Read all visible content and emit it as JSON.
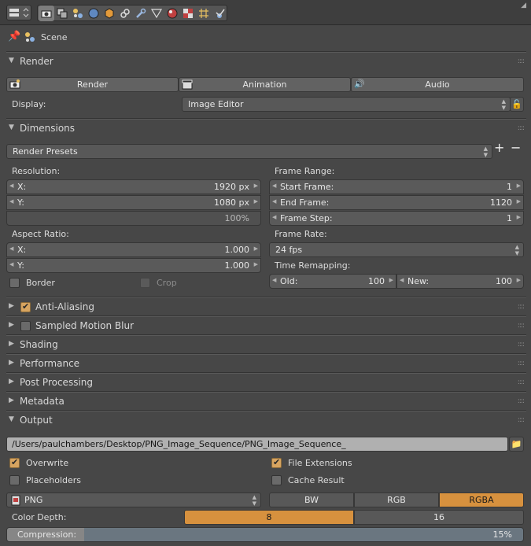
{
  "context": {
    "label": "Scene"
  },
  "render": {
    "title": "Render",
    "render_btn": "Render",
    "animation_btn": "Animation",
    "audio_btn": "Audio",
    "display_label": "Display:",
    "display_value": "Image Editor"
  },
  "dimensions": {
    "title": "Dimensions",
    "presets": "Render Presets",
    "resolution_label": "Resolution:",
    "res_x_label": "X:",
    "res_x": "1920 px",
    "res_y_label": "Y:",
    "res_y": "1080 px",
    "res_pct": "100%",
    "aspect_label": "Aspect Ratio:",
    "asp_x_label": "X:",
    "asp_x": "1.000",
    "asp_y_label": "Y:",
    "asp_y": "1.000",
    "border_label": "Border",
    "crop_label": "Crop",
    "frame_range_label": "Frame Range:",
    "start_label": "Start Frame:",
    "start": "1",
    "end_label": "End Frame:",
    "end": "1120",
    "step_label": "Frame Step:",
    "step": "1",
    "frame_rate_label": "Frame Rate:",
    "frame_rate": "24 fps",
    "remap_label": "Time Remapping:",
    "old_label": "Old:",
    "old": "100",
    "new_label": "New:",
    "new": "100"
  },
  "panels": {
    "anti_aliasing": "Anti-Aliasing",
    "motion_blur": "Sampled Motion Blur",
    "shading": "Shading",
    "performance": "Performance",
    "post_processing": "Post Processing",
    "metadata": "Metadata"
  },
  "output": {
    "title": "Output",
    "path": "/Users/paulchambers/Desktop/PNG_Image_Sequence/PNG_Image_Sequence_",
    "overwrite": "Overwrite",
    "file_extensions": "File Extensions",
    "placeholders": "Placeholders",
    "cache_result": "Cache Result",
    "format": "PNG",
    "bw": "BW",
    "rgb": "RGB",
    "rgba": "RGBA",
    "color_depth_label": "Color Depth:",
    "depth_8": "8",
    "depth_16": "16",
    "compression_label": "Compression:",
    "compression": "15%",
    "compression_fraction": 0.15
  },
  "colors": {
    "accent": "#d7a460",
    "panel": "#474747",
    "field": "#5a5a5a"
  }
}
